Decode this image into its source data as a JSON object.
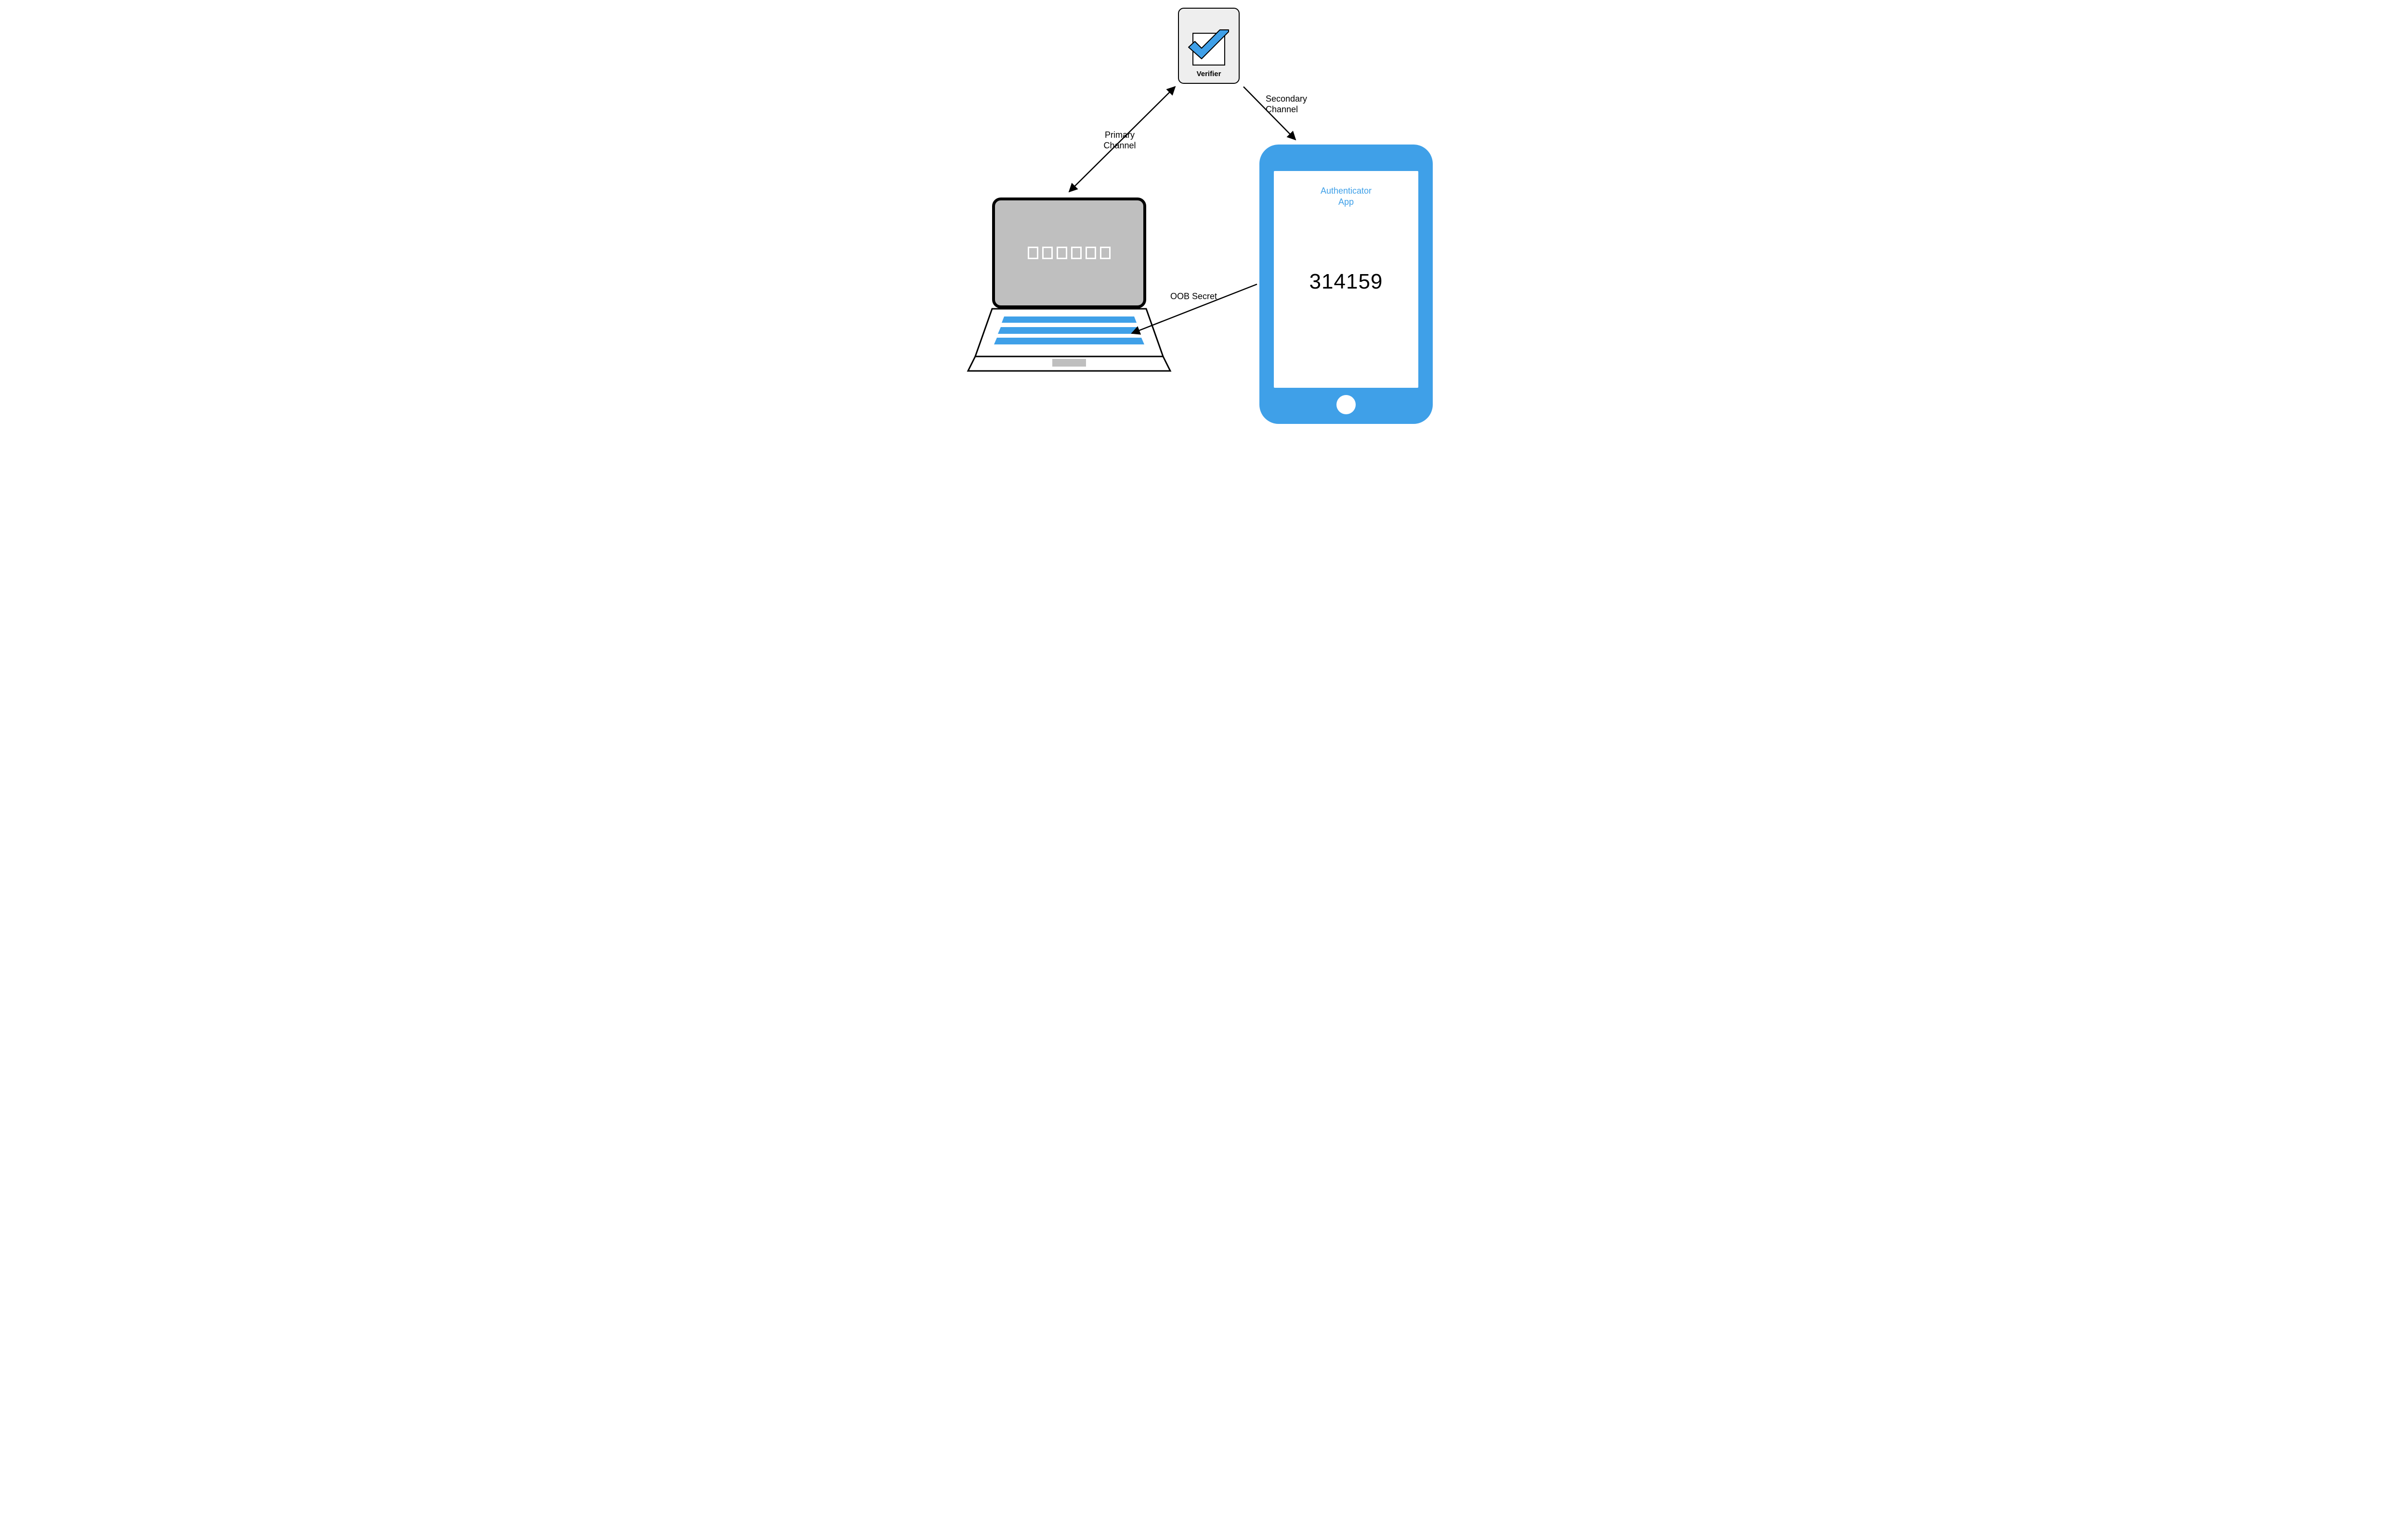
{
  "verifier": {
    "label": "Verifier"
  },
  "edges": {
    "primary": {
      "line1": "Primary",
      "line2": "Channel"
    },
    "secondary": {
      "line1": "Secondary",
      "line2": "Channel"
    },
    "oob": "OOB Secret"
  },
  "phone": {
    "app_label_line1": "Authenticator",
    "app_label_line2": "App",
    "code": "314159"
  },
  "colors": {
    "accent": "#3fa0e8"
  }
}
